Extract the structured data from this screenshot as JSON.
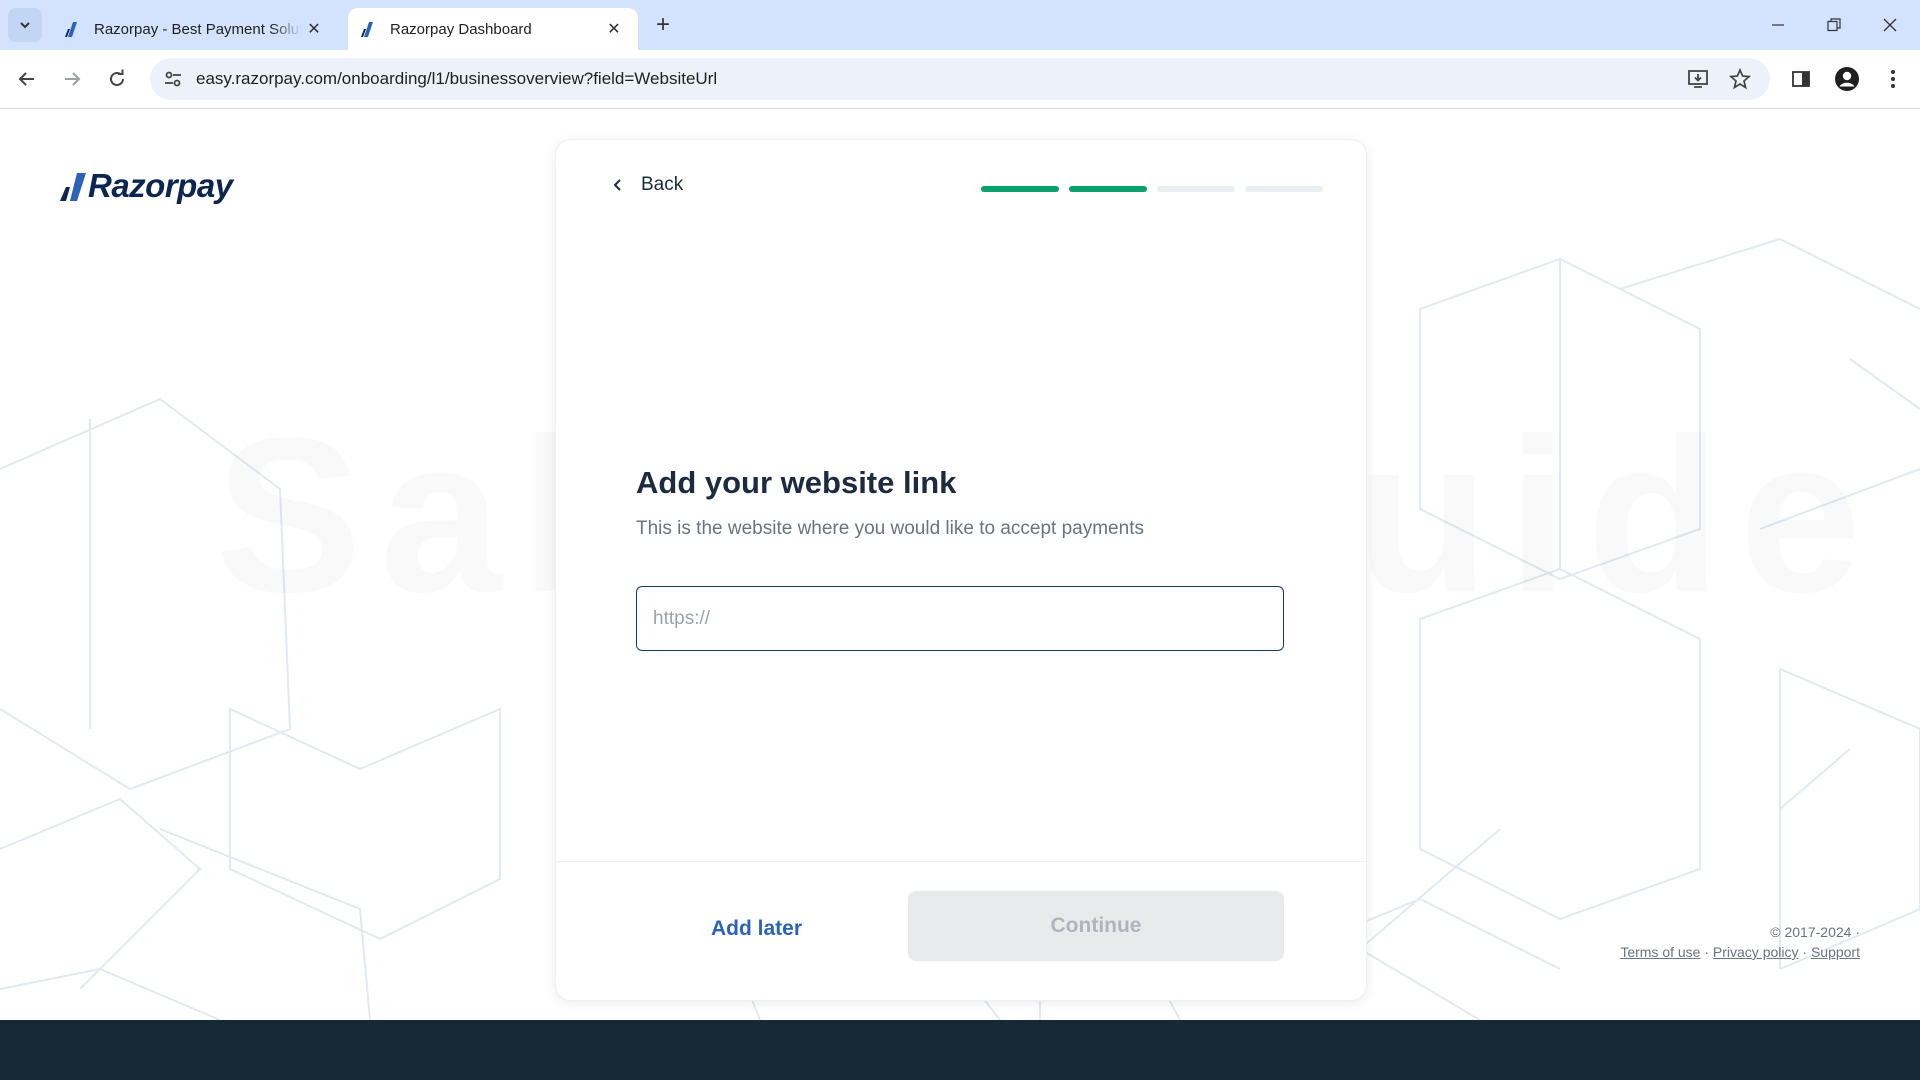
{
  "browser": {
    "tabs": [
      {
        "title": "Razorpay - Best Payment Solution",
        "active": false
      },
      {
        "title": "Razorpay Dashboard",
        "active": true
      }
    ],
    "url": "easy.razorpay.com/onboarding/l1/businessoverview?field=WebsiteUrl"
  },
  "page": {
    "logo_text": "Razorpay",
    "watermark": "Sahil R Guide",
    "back_label": "Back",
    "progress": {
      "total_steps": 4,
      "completed_steps": 2
    },
    "heading": "Add your website link",
    "subtext": "This is the website where you would like to accept payments",
    "website_input": {
      "placeholder": "https://",
      "value": ""
    },
    "add_later_label": "Add later",
    "continue_label": "Continue",
    "footer": {
      "copyright": "© 2017-2024 ·",
      "terms": "Terms of use",
      "privacy": "Privacy policy",
      "support": "Support"
    }
  },
  "colors": {
    "accent_green": "#0a9f6b",
    "inactive_progress": "#e9eef1",
    "link_blue": "#2b64b5",
    "brand_navy": "#0c2651",
    "bottom_bar": "#162935"
  }
}
